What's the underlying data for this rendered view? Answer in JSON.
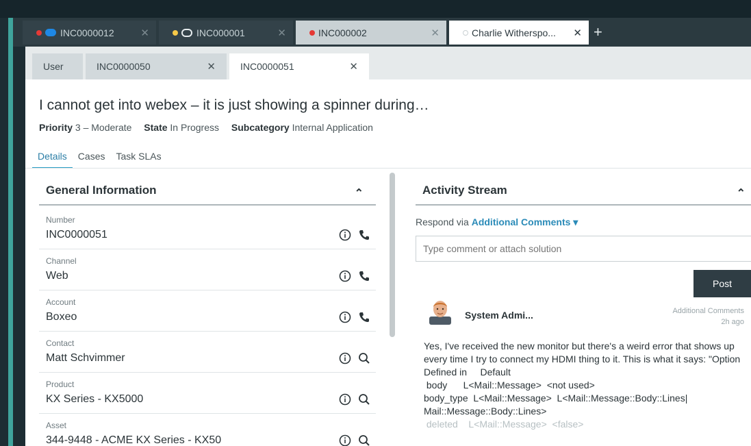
{
  "window_tabs": [
    {
      "label": "INC0000012",
      "dot_color": "#e53935",
      "icon": "chat-solid-icon"
    },
    {
      "label": "INC000001",
      "dot_color": "#f7c948",
      "icon": "chat-outline-icon"
    },
    {
      "label": "INC000002",
      "dot_color": "#e53935"
    },
    {
      "label": "Charlie Witherspo...",
      "dot_color": "#ffffff"
    }
  ],
  "sub_tabs": [
    {
      "label": "User"
    },
    {
      "label": "INC0000050"
    },
    {
      "label": "INC0000051"
    }
  ],
  "record": {
    "title": "I cannot get into webex – it is just showing a spinner during…",
    "meta": {
      "priority_label": "Priority",
      "priority_value": "3 – Moderate",
      "state_label": "State",
      "state_value": "In Progress",
      "subcategory_label": "Subcategory",
      "subcategory_value": "Internal Application"
    }
  },
  "nav_tabs": [
    "Details",
    "Cases",
    "Task SLAs"
  ],
  "general_info": {
    "heading": "General Information",
    "fields": [
      {
        "label": "Number",
        "value": "INC0000051",
        "action_icon": "phone-icon"
      },
      {
        "label": "Channel",
        "value": "Web",
        "action_icon": "phone-icon"
      },
      {
        "label": "Account",
        "value": "Boxeo",
        "action_icon": "phone-icon"
      },
      {
        "label": "Contact",
        "value": "Matt Schvimmer",
        "action_icon": "search-icon"
      },
      {
        "label": "Product",
        "value": "KX Series - KX5000",
        "action_icon": "search-icon"
      },
      {
        "label": "Asset",
        "value": "344-9448 - ACME KX Series - KX50",
        "action_icon": "search-icon"
      }
    ]
  },
  "activity": {
    "heading": "Activity Stream",
    "respond_prefix": "Respond via",
    "respond_option": "Additional Comments",
    "input_placeholder": "Type comment or attach solution",
    "post_label": "Post",
    "entry": {
      "author": "System Admi...",
      "type": "Additional Comments",
      "time": "2h ago",
      "lines": [
        "Yes, I've received the new monitor but there's a weird error that shows up every time I try to connect my HDMI thing to it. This is what it says: \"Option    Defined in     Default",
        " body      L<Mail::Message>  <not used>",
        "body_type  L<Mail::Message>  L<Mail::Message::Body::Lines|",
        "Mail::Message::Body::Lines>",
        " deleted    L<Mail::Message>  <false>"
      ]
    }
  }
}
